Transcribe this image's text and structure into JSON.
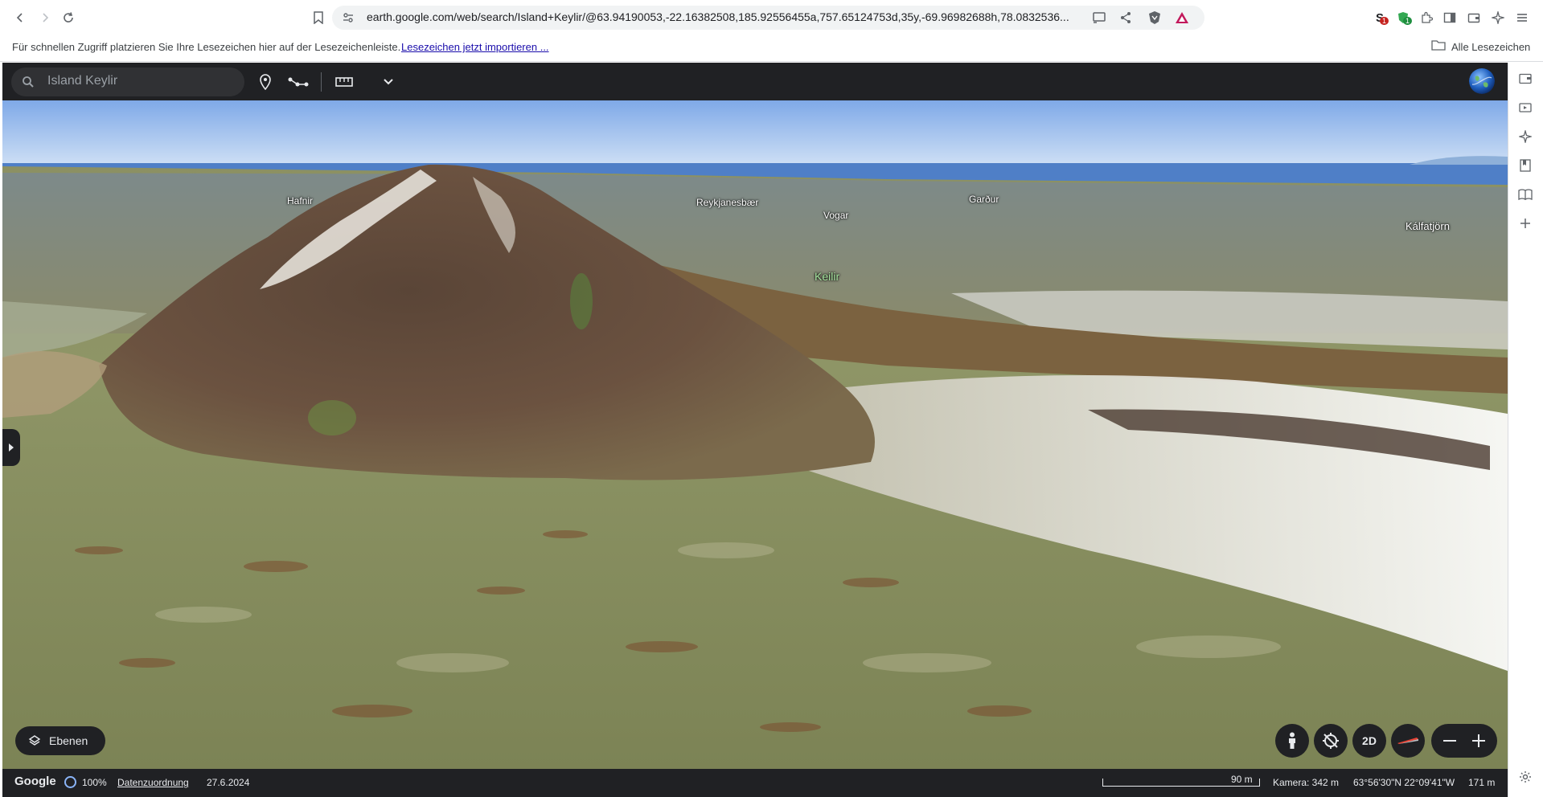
{
  "browser": {
    "url": "earth.google.com/web/search/Island+Keylir/@63.94190053,-22.16382508,185.92556455a,757.65124753d,35y,-69.96982688h,78.0832536...",
    "extensions": {
      "ext1_badge": "1",
      "ext2_badge": "1"
    }
  },
  "bookmarks_bar": {
    "message": "Für schnellen Zugriff platzieren Sie Ihre Lesezeichen hier auf der Lesezeichenleiste.",
    "import_link": "Lesezeichen jetzt importieren ...",
    "all_bookmarks": "Alle Lesezeichen"
  },
  "earth_header": {
    "search_value": "Island Keylir"
  },
  "map": {
    "labels": {
      "hafnir": "Hafnir",
      "reykjanesbaer": "Reykjanesbær",
      "vogar": "Vogar",
      "gardur": "Garður",
      "kalfatjorn": "Kálfatjörn",
      "keilir": "Keilir"
    },
    "layers_button": "Ebenen",
    "view_2d": "2D"
  },
  "status_bar": {
    "google": "Google",
    "load_percent": "100%",
    "attribution": "Datenzuordnung",
    "date": "27.6.2024",
    "scale": "90 m",
    "camera": "Kamera: 342 m",
    "coords": "63°56'30\"N 22°09'41\"W",
    "elevation": "171 m"
  },
  "colors": {
    "header_bg": "#202124",
    "link": "#1a0dab",
    "keilir_label": "#a8e6a1"
  }
}
